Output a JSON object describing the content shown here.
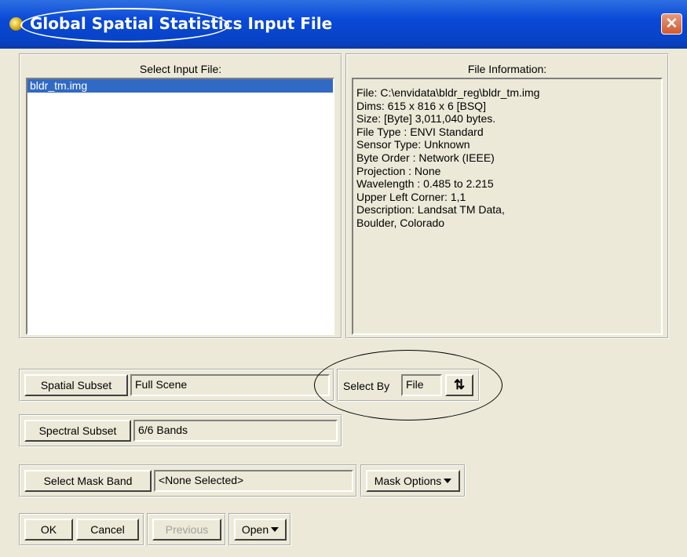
{
  "window": {
    "title": "Global Spatial Statistics Input File",
    "close_glyph": "✕"
  },
  "select_input": {
    "header": "Select Input File:",
    "files": [
      "bldr_tm.img"
    ],
    "selected_index": 0
  },
  "file_info": {
    "header": "File Information:",
    "lines": [
      "File: C:\\envidata\\bldr_reg\\bldr_tm.img",
      "Dims: 615 x 816 x 6 [BSQ]",
      "Size: [Byte] 3,011,040 bytes.",
      "File Type  : ENVI Standard",
      "Sensor Type: Unknown",
      "Byte Order : Network (IEEE)",
      "Projection : None",
      "Wavelength : 0.485 to 2.215",
      "Upper Left Corner: 1,1",
      "Description: Landsat TM Data,",
      "Boulder, Colorado"
    ]
  },
  "spatial_subset": {
    "button": "Spatial Subset",
    "value": "Full Scene"
  },
  "select_by": {
    "label": "Select By",
    "value": "File",
    "toggle_glyph": "⇅"
  },
  "spectral_subset": {
    "button": "Spectral Subset",
    "value": "6/6 Bands"
  },
  "mask": {
    "button": "Select Mask Band",
    "value": "<None Selected>",
    "options_button": "Mask Options"
  },
  "actions": {
    "ok": "OK",
    "cancel": "Cancel",
    "previous": "Previous",
    "open": "Open"
  },
  "colors": {
    "title_bar": "#0a49d8",
    "selection": "#316ac5",
    "dialog_bg": "#ece9d8",
    "close_button": "#d05a2e"
  }
}
